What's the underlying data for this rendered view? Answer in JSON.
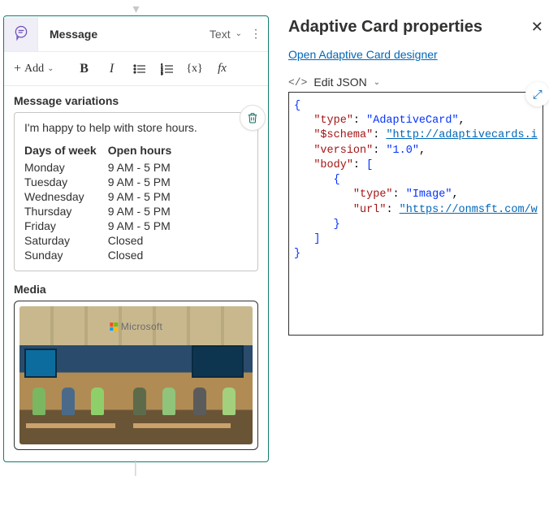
{
  "message_node": {
    "title": "Message",
    "type_label": "Text",
    "add_label": "Add",
    "variations_label": "Message variations",
    "media_label": "Media",
    "intro_text": "I'm happy to help with store hours.",
    "table_headers": {
      "col1": "Days of week",
      "col2": "Open hours"
    },
    "hours": [
      {
        "day": "Monday",
        "hours": "9 AM - 5 PM"
      },
      {
        "day": "Tuesday",
        "hours": "9 AM - 5 PM"
      },
      {
        "day": "Wednesday",
        "hours": "9 AM - 5 PM"
      },
      {
        "day": "Thursday",
        "hours": "9 AM - 5 PM"
      },
      {
        "day": "Friday",
        "hours": "9 AM - 5 PM"
      },
      {
        "day": "Saturday",
        "hours": "Closed"
      },
      {
        "day": "Sunday",
        "hours": "Closed"
      }
    ],
    "media_brand": "Microsoft"
  },
  "panel": {
    "title": "Adaptive Card properties",
    "designer_link": "Open Adaptive Card designer",
    "edit_json_label": "Edit JSON",
    "json": {
      "type_key": "\"type\"",
      "type_val": "\"AdaptiveCard\"",
      "schema_key": "\"$schema\"",
      "schema_val": "\"http://adaptivecards.i",
      "version_key": "\"version\"",
      "version_val": "\"1.0\"",
      "body_key": "\"body\"",
      "body_type_key": "\"type\"",
      "body_type_val": "\"Image\"",
      "url_key": "\"url\"",
      "url_val": "\"https://onmsft.com/w"
    }
  }
}
